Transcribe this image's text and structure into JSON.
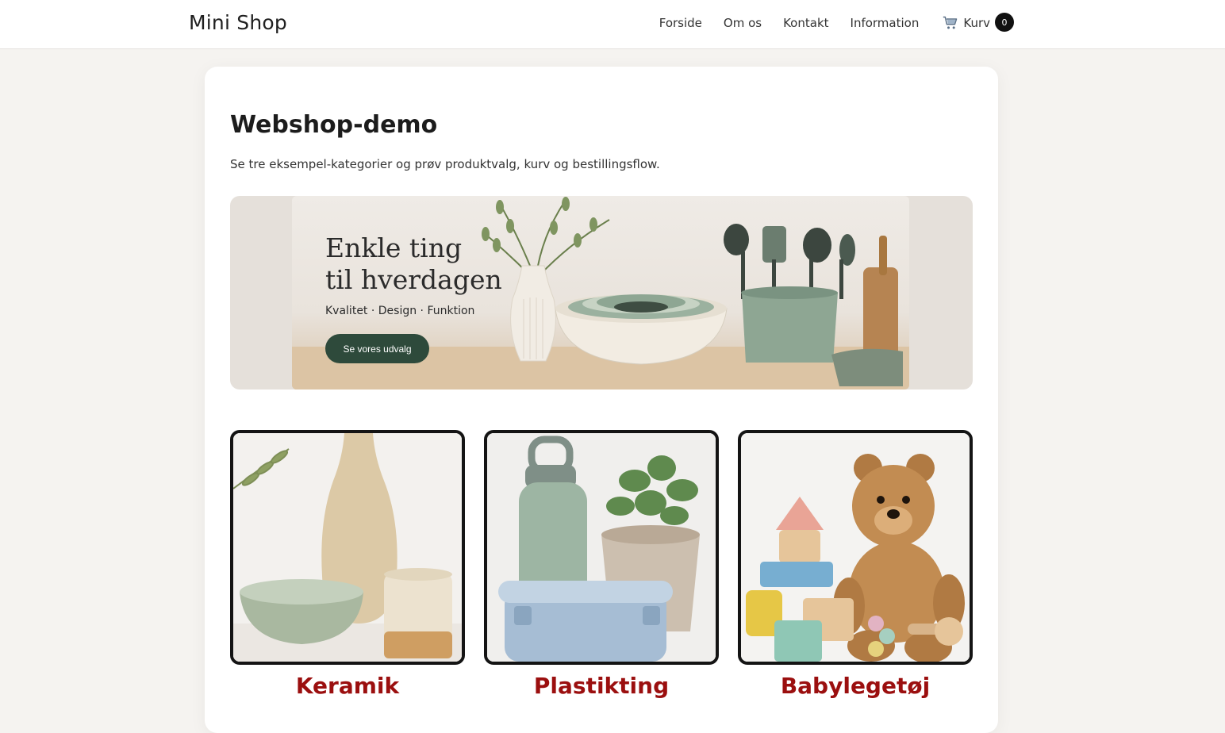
{
  "header": {
    "brand": "Mini Shop",
    "nav": [
      "Forside",
      "Om os",
      "Kontakt",
      "Information"
    ],
    "cart_label": "Kurv",
    "cart_count": "0"
  },
  "main": {
    "title": "Webshop-demo",
    "intro": "Se tre eksempel-kategorier og prøv produktvalg, kurv og bestillingsflow."
  },
  "hero": {
    "title_line1": "Enkle ting",
    "title_line2": "til hverdagen",
    "subtitle": "Kvalitet · Design · Funktion",
    "button": "Se vores udvalg"
  },
  "categories": [
    {
      "label": "Keramik"
    },
    {
      "label": "Plastikting"
    },
    {
      "label": "Babylegetøj"
    }
  ],
  "colors": {
    "accent_dark_green": "#2e4a3b",
    "category_label": "#9b0f0f",
    "badge": "#111111",
    "page_bg": "#f5f3f0"
  },
  "icons": {
    "cart": "shopping-cart-icon"
  }
}
